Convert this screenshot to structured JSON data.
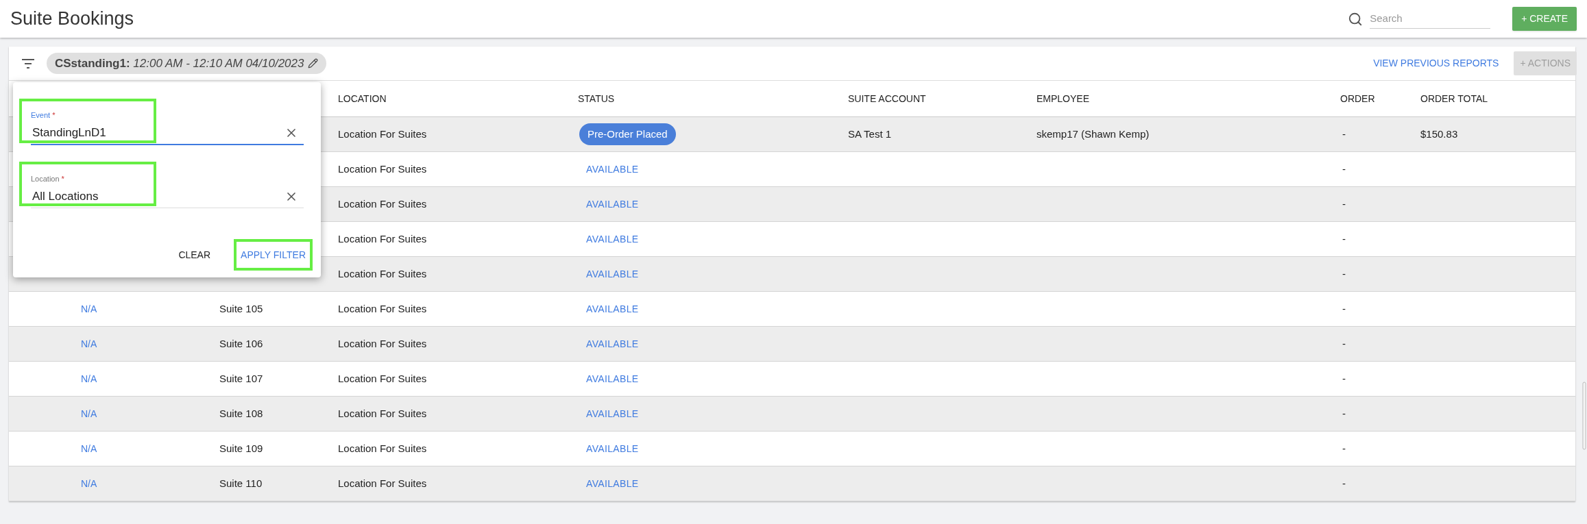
{
  "page": {
    "title": "Suite Bookings"
  },
  "search": {
    "placeholder": "Search"
  },
  "create_button": {
    "label": "+ CREATE"
  },
  "filter_chip": {
    "name": "CSstanding1:",
    "time": "12:00 AM - 12:10 AM 04/10/2023"
  },
  "view_reports_link": {
    "label": "VIEW PREVIOUS REPORTS"
  },
  "actions_button": {
    "label": "+ ACTIONS",
    "disabled": true
  },
  "filter_popup": {
    "fields": [
      {
        "label": "Event",
        "required_mark": "*",
        "value": "StandingLnD1",
        "focused": true,
        "highlighted": true
      },
      {
        "label": "Location",
        "required_mark": "*",
        "value": "All Locations",
        "focused": false,
        "highlighted": true
      }
    ],
    "buttons": [
      {
        "label": "CLEAR",
        "kind": "plain",
        "highlighted": false
      },
      {
        "label": "APPLY FILTER",
        "kind": "primary",
        "highlighted": true
      }
    ]
  },
  "table": {
    "columns": [
      {
        "label": "LOCATION"
      },
      {
        "label": "STATUS"
      },
      {
        "label": "SUITE ACCOUNT"
      },
      {
        "label": "EMPLOYEE"
      },
      {
        "label": "ORDER"
      },
      {
        "label": "ORDER TOTAL"
      }
    ],
    "rows": [
      {
        "location": "Location For Suites",
        "status": {
          "label": "Pre-Order Placed",
          "kind": "badge"
        },
        "suite_account": "SA Test 1",
        "employee": "skemp17 (Shawn Kemp)",
        "order": "-",
        "order_total": "$150.83"
      },
      {
        "location": "Location For Suites",
        "status": {
          "label": "AVAILABLE",
          "kind": "link"
        },
        "order": "-"
      },
      {
        "location": "Location For Suites",
        "status": {
          "label": "AVAILABLE",
          "kind": "link"
        },
        "order": "-"
      },
      {
        "location": "Location For Suites",
        "status": {
          "label": "AVAILABLE",
          "kind": "link"
        },
        "order": "-"
      },
      {
        "location": "Location For Suites",
        "status": {
          "label": "AVAILABLE",
          "kind": "link"
        },
        "order": "-"
      },
      {
        "column_1": "N/A",
        "column_2": "Suite 105",
        "location": "Location For Suites",
        "status": {
          "label": "AVAILABLE",
          "kind": "link"
        },
        "order": "-"
      },
      {
        "column_1": "N/A",
        "column_2": "Suite 106",
        "location": "Location For Suites",
        "status": {
          "label": "AVAILABLE",
          "kind": "link"
        },
        "order": "-"
      },
      {
        "column_1": "N/A",
        "column_2": "Suite 107",
        "location": "Location For Suites",
        "status": {
          "label": "AVAILABLE",
          "kind": "link"
        },
        "order": "-"
      },
      {
        "column_1": "N/A",
        "column_2": "Suite 108",
        "location": "Location For Suites",
        "status": {
          "label": "AVAILABLE",
          "kind": "link"
        },
        "order": "-"
      },
      {
        "column_1": "N/A",
        "column_2": "Suite 109",
        "location": "Location For Suites",
        "status": {
          "label": "AVAILABLE",
          "kind": "link"
        },
        "order": "-"
      },
      {
        "column_1": "N/A",
        "column_2": "Suite 110",
        "location": "Location For Suites",
        "status": {
          "label": "AVAILABLE",
          "kind": "link"
        },
        "order": "-"
      }
    ]
  }
}
